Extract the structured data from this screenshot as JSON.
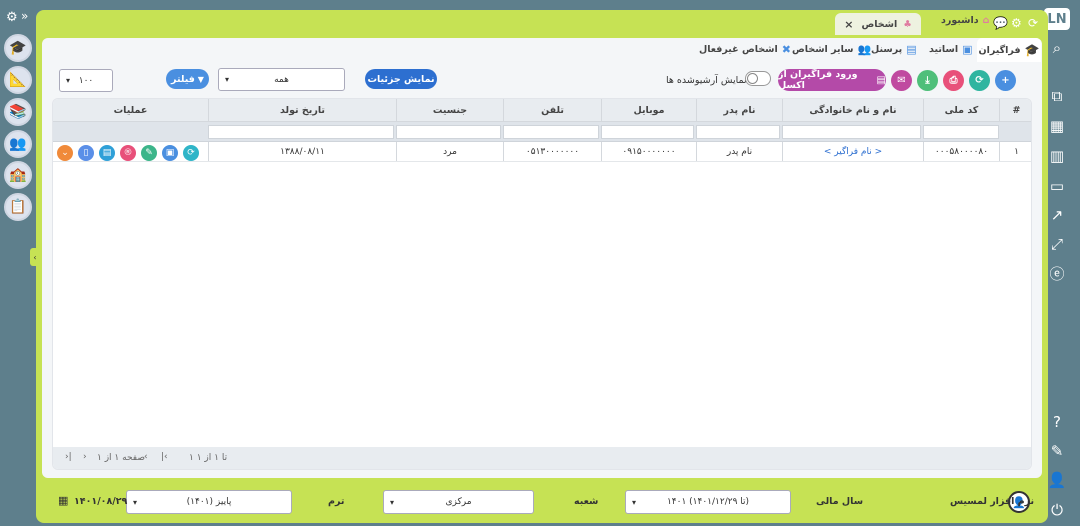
{
  "tabs": {
    "active": "اشخاص",
    "inactive": "داشبورد",
    "close": "×"
  },
  "subtabs": [
    "فراگیران",
    "اساتید",
    "پرسنل",
    "سایر اشخاص",
    "اشخاص غیرفعال"
  ],
  "toolbar": {
    "add": "+",
    "refresh": "⟳",
    "print": "⎙",
    "export": "⤓",
    "mail": "✉",
    "import_excel": "ورود فراگیران از اکسل",
    "archived_label": "نمایش آرشیوشده ها",
    "details_btn": "نمایش جزئیات",
    "filter_select": "همه",
    "filter_btn": "فیلتر",
    "page_size": "۱۰۰"
  },
  "grid": {
    "headers": [
      "#",
      "کد ملی",
      "نام و نام خانوادگی",
      "نام پدر",
      "موبایل",
      "تلفن",
      "جنسیت",
      "تاریخ تولد",
      "عملیات"
    ],
    "rows": [
      [
        "۱",
        "۰۰۰۵۸۰۰۰۰۸۰",
        "< نام فراگیر >",
        "نام پدر",
        "۰۹۱۵۰۰۰۰۰۰۰",
        "۰۵۱۳۰۰۰۰۰۰۰",
        "مرد",
        "۱۳۸۸/۰۸/۱۱",
        ""
      ]
    ],
    "footer_count": "۱ تا ۱ از ۱",
    "footer_page": "صفحه ۱ از ۱"
  },
  "bottom": {
    "brand": "نرم افزار لمسیس",
    "fiscal_label": "سال مالی",
    "fiscal_value": "۱۴۰۱ (تا ۱۴۰۱/۱۲/۲۹)",
    "branch_label": "شعبه",
    "branch_value": "مرکزی",
    "term_label": "ترم",
    "term_value": "پاییز (۱۴۰۱)",
    "date": "۱۴۰۱/۰۸/۲۹"
  }
}
